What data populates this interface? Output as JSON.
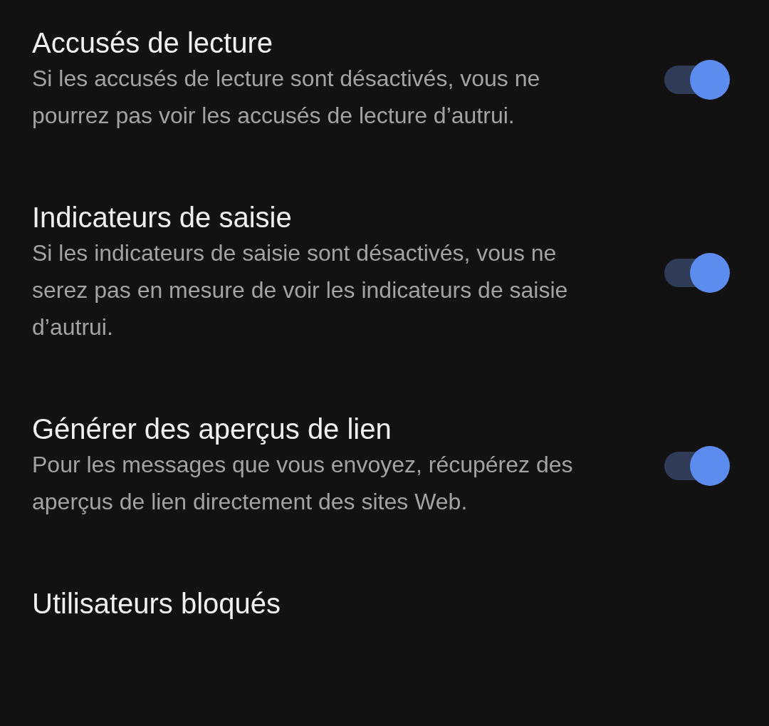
{
  "settings": [
    {
      "kind": "toggle",
      "title": "Accusés de lecture",
      "description": "Si les accusés de lecture sont désactivés, vous ne pourrez pas voir les accusés de lecture d’autrui.",
      "on": true
    },
    {
      "kind": "toggle",
      "title": "Indicateurs de saisie",
      "description": "Si les indicateurs de saisie sont désactivés, vous ne serez pas en mesure de voir les indicateurs de saisie d’autrui.",
      "on": true
    },
    {
      "kind": "toggle",
      "title": "Générer des aperçus de lien",
      "description": "Pour les messages que vous envoyez, récupérez des aperçus de lien directement des sites Web.",
      "on": true
    },
    {
      "kind": "link",
      "title": "Utilisateurs bloqués"
    }
  ]
}
